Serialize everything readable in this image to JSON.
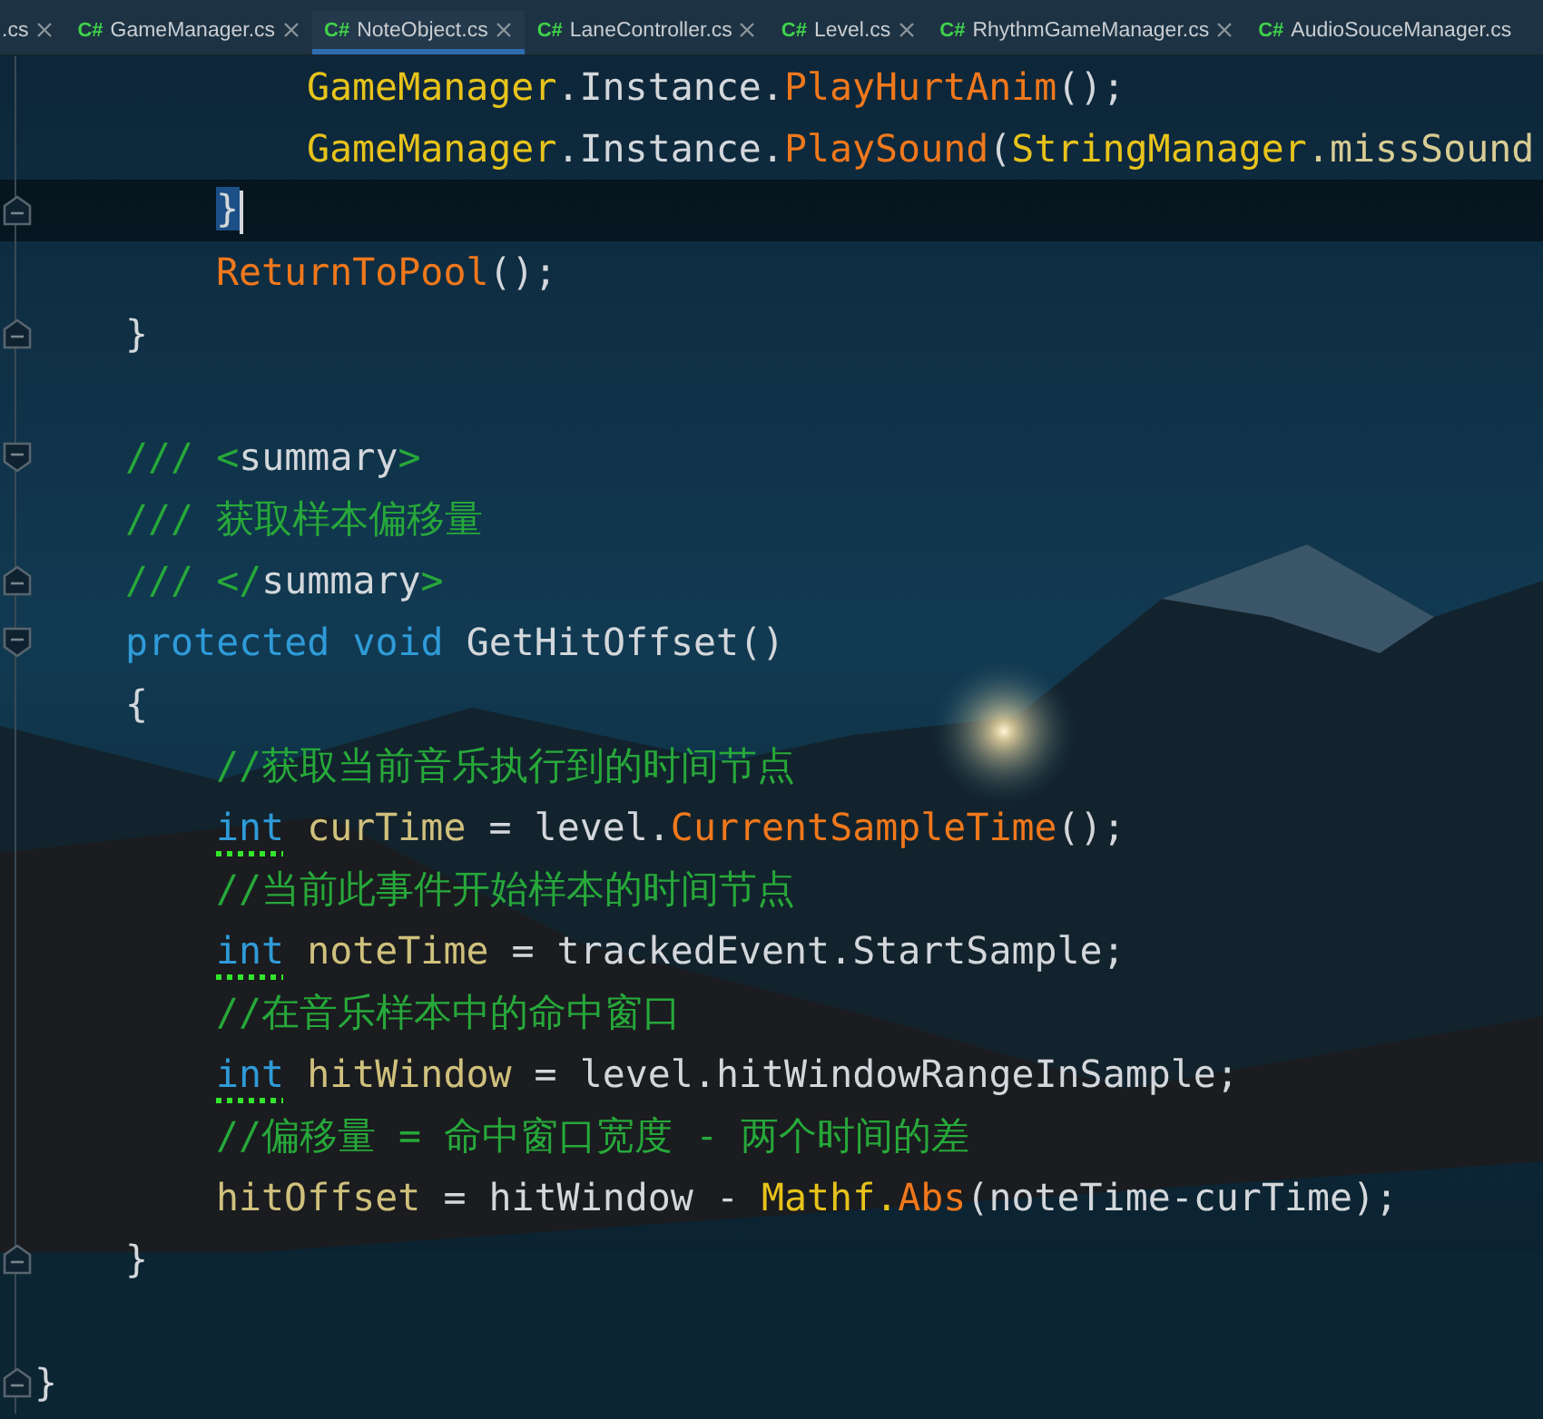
{
  "tabs": [
    {
      "label": ".cs",
      "closable": true,
      "selected": false
    },
    {
      "icon": "C#",
      "label": "GameManager.cs",
      "closable": true,
      "selected": false
    },
    {
      "icon": "C#",
      "label": "NoteObject.cs",
      "closable": true,
      "selected": true
    },
    {
      "icon": "C#",
      "label": "LaneController.cs",
      "closable": true,
      "selected": false
    },
    {
      "icon": "C#",
      "label": "Level.cs",
      "closable": true,
      "selected": false
    },
    {
      "icon": "C#",
      "label": "RhythmGameManager.cs",
      "closable": true,
      "selected": false
    },
    {
      "icon": "C#",
      "label": "AudioSouceManager.cs",
      "closable": false,
      "selected": false
    }
  ],
  "code_lines": [
    {
      "kind": "group",
      "children": [
        {
          "kind": "group",
          "children": [
            {
              "kind": "group",
              "children": [
                {
                  "kind": "code",
                  "fold_start": false,
                  "fold_end": false,
                  "current": false,
                  "tokens": [
                    {
                      "kind": "class",
                      "text": "GameManager"
                    },
                    {
                      "kind": "plain",
                      "text": ".Instance."
                    },
                    {
                      "kind": "method",
                      "text": "PlayHurtAnim"
                    },
                    {
                      "kind": "plain",
                      "text": "();"
                    }
                  ]
                },
                {
                  "kind": "code",
                  "fold_start": false,
                  "fold_end": false,
                  "current": false,
                  "tokens": [
                    {
                      "kind": "class",
                      "text": "GameManager"
                    },
                    {
                      "kind": "plain",
                      "text": ".Instance."
                    },
                    {
                      "kind": "method",
                      "text": "PlaySound"
                    },
                    {
                      "kind": "plain",
                      "text": "("
                    },
                    {
                      "kind": "class",
                      "text": "StringManager"
                    },
                    {
                      "kind": "field",
                      "text": ".missSound"
                    }
                  ]
                }
              ]
            },
            {
              "kind": "code",
              "fold_start": false,
              "fold_end": true,
              "current": true,
              "tokens": [
                {
                  "kind": "brace-match",
                  "text": "}"
                }
              ]
            },
            {
              "kind": "code",
              "fold_start": false,
              "fold_end": false,
              "current": false,
              "tokens": [
                {
                  "kind": "method",
                  "text": "ReturnToPool"
                },
                {
                  "kind": "plain",
                  "text": "();"
                }
              ]
            }
          ]
        },
        {
          "kind": "code",
          "fold_start": false,
          "fold_end": true,
          "current": false,
          "tokens": [
            {
              "kind": "plain",
              "text": "}"
            }
          ]
        },
        {
          "kind": "blank"
        },
        {
          "kind": "code",
          "fold_start": true,
          "fold_end": false,
          "current": false,
          "tokens": [
            {
              "kind": "comment",
              "text": "/// <"
            },
            {
              "kind": "plain",
              "text": "summary"
            },
            {
              "kind": "comment",
              "text": ">"
            }
          ]
        },
        {
          "kind": "code",
          "fold_start": false,
          "fold_end": false,
          "current": false,
          "tokens": [
            {
              "kind": "comment",
              "text": "/// 获取样本偏移量"
            }
          ]
        },
        {
          "kind": "code",
          "fold_start": false,
          "fold_end": true,
          "current": false,
          "tokens": [
            {
              "kind": "comment",
              "text": "/// </"
            },
            {
              "kind": "plain",
              "text": "summary"
            },
            {
              "kind": "comment",
              "text": ">"
            }
          ]
        },
        {
          "kind": "code",
          "fold_start": true,
          "fold_end": false,
          "current": false,
          "tokens": [
            {
              "kind": "keyword",
              "text": "protected void"
            },
            {
              "kind": "plain",
              "text": " GetHitOffset()"
            }
          ]
        },
        {
          "kind": "code",
          "fold_start": false,
          "fold_end": false,
          "current": false,
          "tokens": [
            {
              "kind": "plain",
              "text": "{"
            }
          ],
          "children": [
            {
              "kind": "code",
              "fold_start": false,
              "fold_end": false,
              "current": false,
              "tokens": [
                {
                  "kind": "comment",
                  "text": "//获取当前音乐执行到的时间节点"
                }
              ]
            },
            {
              "kind": "code",
              "fold_start": false,
              "fold_end": false,
              "current": false,
              "tokens": [
                {
                  "kind": "keyword-warning",
                  "text": "int"
                },
                {
                  "kind": "local",
                  "text": " curTime"
                },
                {
                  "kind": "plain",
                  "text": " = level."
                },
                {
                  "kind": "method",
                  "text": "CurrentSampleTime"
                },
                {
                  "kind": "plain",
                  "text": "();"
                }
              ]
            },
            {
              "kind": "code",
              "fold_start": false,
              "fold_end": false,
              "current": false,
              "tokens": [
                {
                  "kind": "comment",
                  "text": "//当前此事件开始样本的时间节点"
                }
              ]
            },
            {
              "kind": "code",
              "fold_start": false,
              "fold_end": false,
              "current": false,
              "tokens": [
                {
                  "kind": "keyword-warning",
                  "text": "int"
                },
                {
                  "kind": "local",
                  "text": " noteTime"
                },
                {
                  "kind": "plain",
                  "text": " = trackedEvent.StartSample;"
                }
              ]
            },
            {
              "kind": "code",
              "fold_start": false,
              "fold_end": false,
              "current": false,
              "tokens": [
                {
                  "kind": "comment",
                  "text": "//在音乐样本中的命中窗口"
                }
              ]
            },
            {
              "kind": "code",
              "fold_start": false,
              "fold_end": false,
              "current": false,
              "tokens": [
                {
                  "kind": "keyword-warning",
                  "text": "int"
                },
                {
                  "kind": "local",
                  "text": " hitWindow"
                },
                {
                  "kind": "plain",
                  "text": " = level.hitWindowRangeInSample;"
                }
              ]
            },
            {
              "kind": "code",
              "fold_start": false,
              "fold_end": false,
              "current": false,
              "tokens": [
                {
                  "kind": "comment",
                  "text": "//偏移量 = 命中窗口宽度 - 两个时间的差"
                }
              ]
            },
            {
              "kind": "code",
              "fold_start": false,
              "fold_end": false,
              "current": false,
              "tokens": [
                {
                  "kind": "local",
                  "text": "hitOffset"
                },
                {
                  "kind": "plain",
                  "text": " = hitWindow - "
                },
                {
                  "kind": "class",
                  "text": "Mathf."
                },
                {
                  "kind": "method",
                  "text": "Abs"
                },
                {
                  "kind": "plain",
                  "text": "(noteTime-curTime);"
                }
              ]
            }
          ]
        },
        {
          "kind": "code",
          "fold_start": false,
          "fold_end": true,
          "current": false,
          "tokens": [
            {
              "kind": "plain",
              "text": "}"
            }
          ]
        },
        {
          "kind": "blank"
        }
      ]
    },
    {
      "kind": "code",
      "fold_start": false,
      "fold_end": true,
      "current": false,
      "tokens": [
        {
          "kind": "plain",
          "text": "}"
        }
      ]
    }
  ]
}
